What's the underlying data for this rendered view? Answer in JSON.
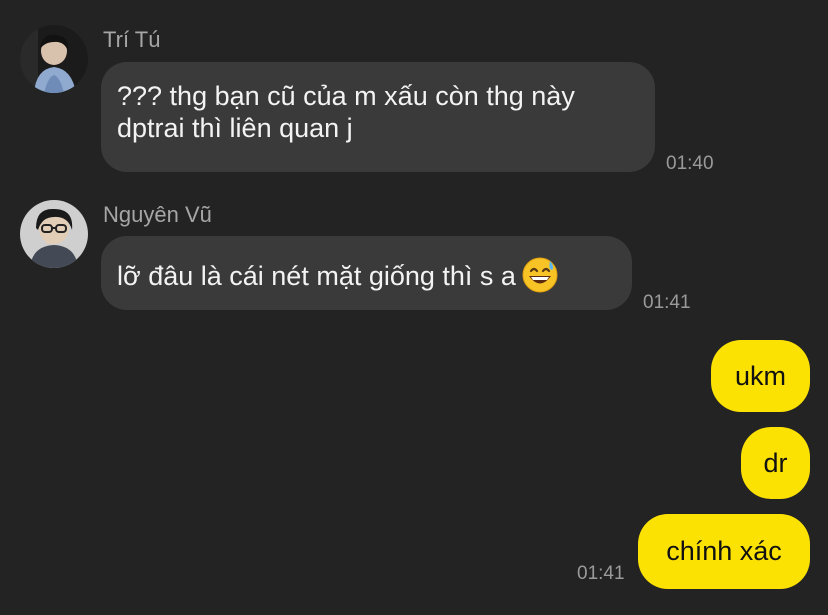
{
  "colors": {
    "background": "#232323",
    "incoming_bubble": "#3a3a3b",
    "outgoing_bubble": "#fce203",
    "meta_text": "#a6a6a6"
  },
  "messages": {
    "m1": {
      "sender": "Trí Tú",
      "text_line1": "??? thg bạn cũ của m xấu còn thg này",
      "text_line2": "dptrai thì liên quan j",
      "time": "01:40"
    },
    "m2": {
      "sender": "Nguyên Vũ",
      "text": "lỡ đâu là cái nét mặt giống thì s a",
      "emoji": "grinning-face-with-sweat-icon",
      "time": "01:41"
    },
    "m3": {
      "text": "ukm"
    },
    "m4": {
      "text": "dr"
    },
    "m5": {
      "text": "chính xác",
      "time": "01:41"
    }
  }
}
